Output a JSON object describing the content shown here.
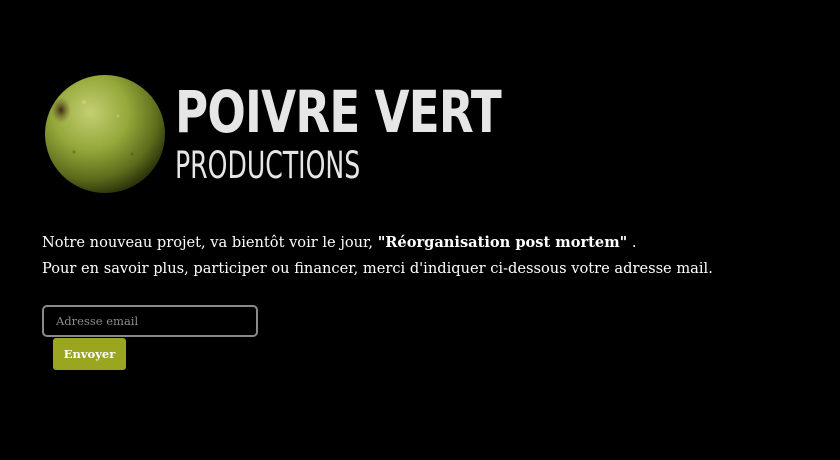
{
  "brand": {
    "title": "POIVRE VERT",
    "subtitle": "PRODUCTIONS",
    "icon": "green-peppercorn-icon"
  },
  "intro": {
    "line1_prefix": "Notre nouveau projet, va bientôt voir le jour, ",
    "project_name": "\"Réorganisation post mortem\"",
    "line1_suffix": " .",
    "line2": "Pour en savoir plus, participer ou financer, merci d'indiquer ci-dessous votre adresse mail."
  },
  "form": {
    "email_placeholder": "Adresse email",
    "email_value": "",
    "submit_label": "Envoyer"
  },
  "colors": {
    "background": "#000000",
    "text": "#ffffff",
    "logo_text": "#e6e6e6",
    "button": "#9aa520",
    "input_border": "#8a8a8a"
  }
}
